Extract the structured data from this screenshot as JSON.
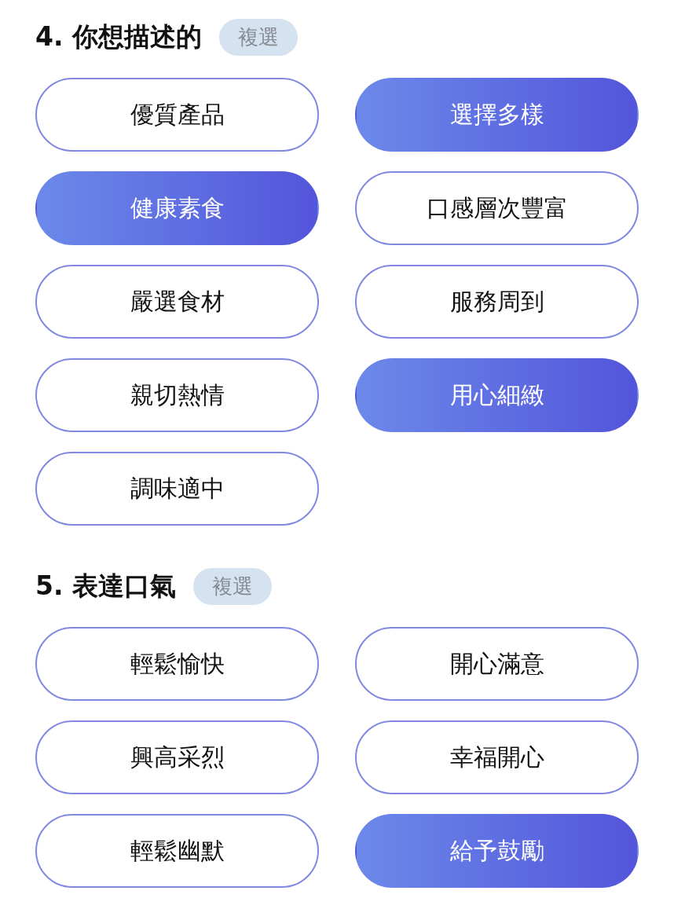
{
  "sections": [
    {
      "title": "4. 你想描述的",
      "badge": "複選",
      "options": [
        {
          "label": "優質產品",
          "selected": false
        },
        {
          "label": "選擇多樣",
          "selected": true
        },
        {
          "label": "健康素食",
          "selected": true
        },
        {
          "label": "口感層次豐富",
          "selected": false
        },
        {
          "label": "嚴選食材",
          "selected": false
        },
        {
          "label": "服務周到",
          "selected": false
        },
        {
          "label": "親切熱情",
          "selected": false
        },
        {
          "label": "用心細緻",
          "selected": true
        },
        {
          "label": "調味適中",
          "selected": false
        }
      ]
    },
    {
      "title": "5. 表達口氣",
      "badge": "複選",
      "options": [
        {
          "label": "輕鬆愉快",
          "selected": false
        },
        {
          "label": "開心滿意",
          "selected": false
        },
        {
          "label": "興高采烈",
          "selected": false
        },
        {
          "label": "幸福開心",
          "selected": false
        },
        {
          "label": "輕鬆幽默",
          "selected": false
        },
        {
          "label": "給予鼓勵",
          "selected": true
        }
      ]
    }
  ]
}
